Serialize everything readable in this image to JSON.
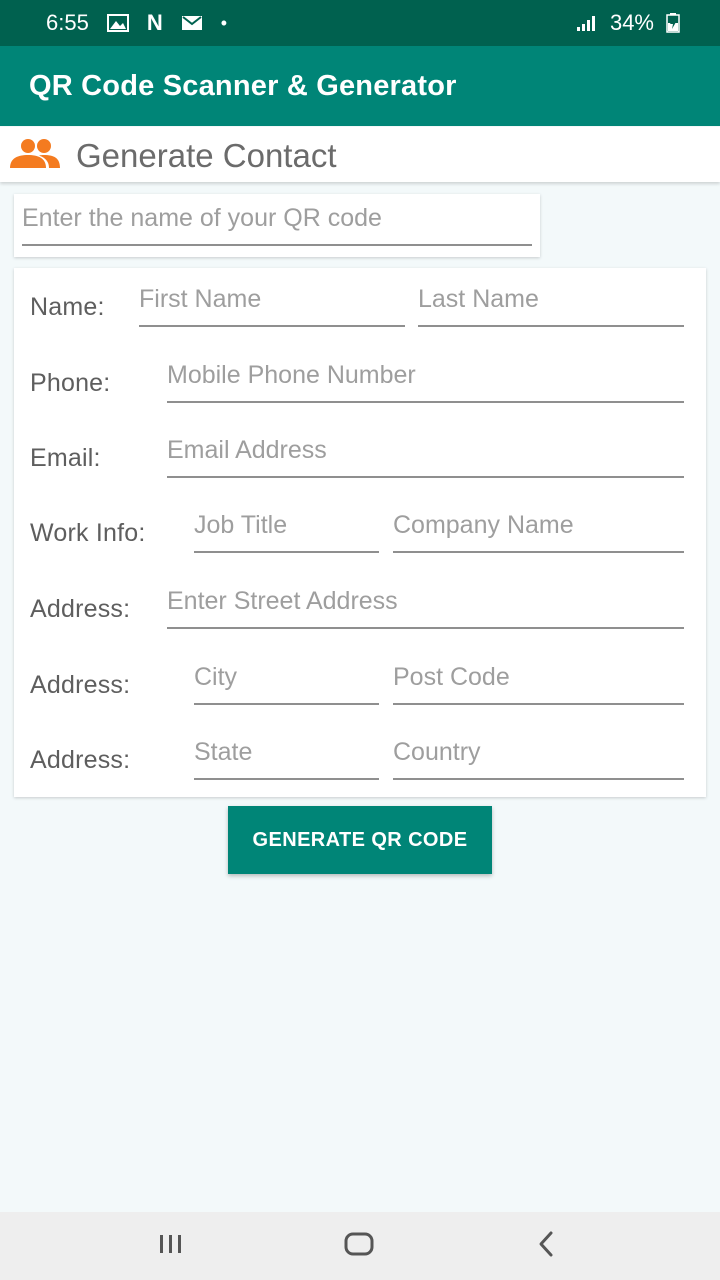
{
  "status_bar": {
    "time": "6:55",
    "battery": "34%",
    "icons": [
      "image-icon",
      "netflix-n-icon",
      "mail-icon",
      "dot-icon",
      "signal-icon",
      "battery-charging-icon"
    ],
    "netflix_glyph": "N",
    "dot_glyph": "•"
  },
  "app_bar": {
    "title": "QR Code Scanner & Generator"
  },
  "section_header": {
    "icon": "people-icon",
    "icon_color": "#f47b20",
    "title": "Generate Contact"
  },
  "qr_name": {
    "placeholder": "Enter the name of your QR code",
    "value": ""
  },
  "form": {
    "name_label": "Name:",
    "first_name_placeholder": "First Name",
    "last_name_placeholder": "Last Name",
    "phone_label": "Phone:",
    "phone_placeholder": "Mobile Phone Number",
    "email_label": "Email:",
    "email_placeholder": "Email Address",
    "work_label": "Work Info:",
    "job_title_placeholder": "Job Title",
    "company_placeholder": "Company Name",
    "street_label": "Address:",
    "street_placeholder": "Enter Street Address",
    "city_label": "Address:",
    "city_placeholder": "City",
    "postcode_placeholder": "Post Code",
    "state_label": "Address:",
    "state_placeholder": "State",
    "country_placeholder": "Country"
  },
  "generate_button": {
    "label": "GENERATE QR CODE"
  },
  "nav_bar": {
    "icons": [
      "recents-icon",
      "home-icon",
      "back-icon"
    ]
  },
  "colors": {
    "status_bar": "#00614f",
    "primary": "#008577",
    "accent": "#f47b20",
    "background": "#f3f9fa"
  }
}
